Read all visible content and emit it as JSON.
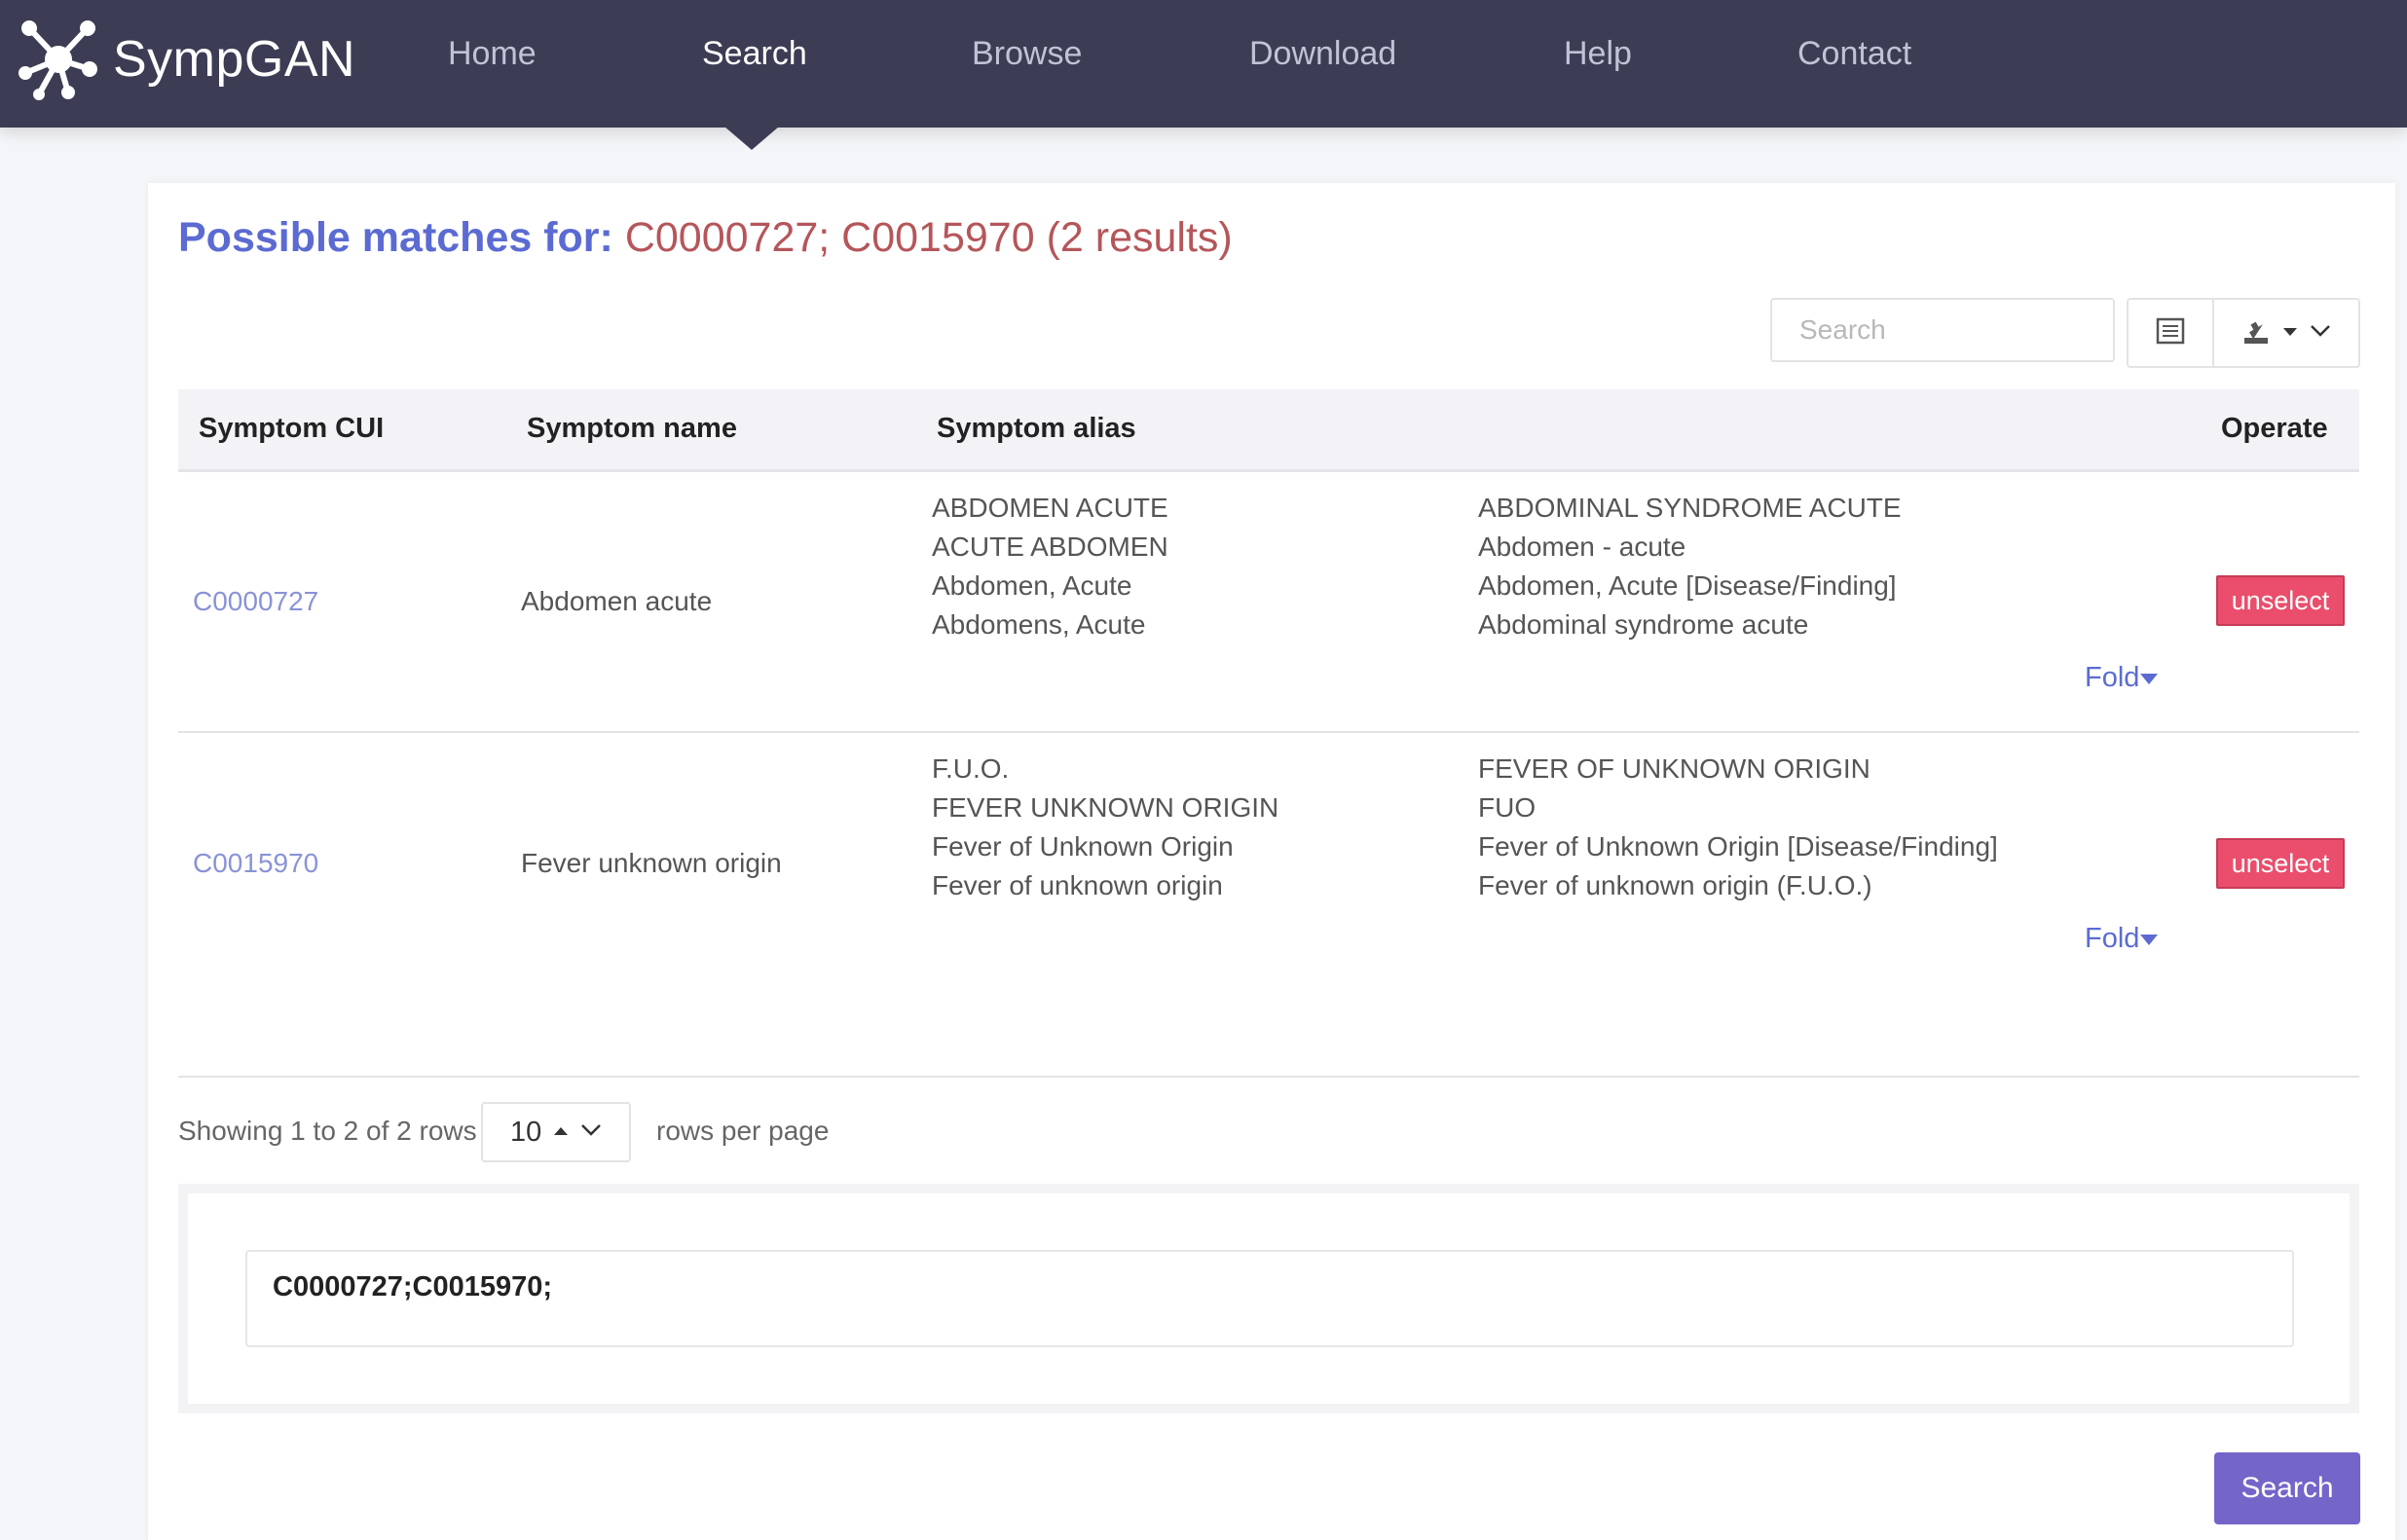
{
  "brand": {
    "name": "SympGAN",
    "logo_icon": "molecule-network-icon"
  },
  "nav": {
    "items": [
      {
        "label": "Home",
        "active": false
      },
      {
        "label": "Search",
        "active": true
      },
      {
        "label": "Browse",
        "active": false
      },
      {
        "label": "Download",
        "active": false
      },
      {
        "label": "Help",
        "active": false
      },
      {
        "label": "Contact",
        "active": false
      }
    ]
  },
  "heading": {
    "label": "Possible matches for:",
    "value": "C0000727; C0015970 (2 results)"
  },
  "toolbar": {
    "search_placeholder": "Search",
    "columns_icon": "list-view-icon",
    "export_icon": "download-export-icon"
  },
  "table": {
    "headers": {
      "cui": "Symptom CUI",
      "name": "Symptom name",
      "alias": "Symptom alias",
      "operate": "Operate"
    },
    "rows": [
      {
        "cui": "C0000727",
        "name": "Abdomen acute",
        "alias_col1": [
          "ABDOMEN ACUTE",
          "ACUTE ABDOMEN",
          "Abdomen, Acute",
          "Abdomens, Acute"
        ],
        "alias_col2": [
          "ABDOMINAL SYNDROME ACUTE",
          "Abdomen - acute",
          "Abdomen, Acute [Disease/Finding]",
          "Abdominal syndrome acute"
        ],
        "fold_label": "Fold",
        "action_label": "unselect"
      },
      {
        "cui": "C0015970",
        "name": "Fever unknown origin",
        "alias_col1": [
          "F.U.O.",
          "FEVER UNKNOWN ORIGIN",
          "Fever of Unknown Origin",
          "Fever of unknown origin"
        ],
        "alias_col2": [
          "FEVER OF UNKNOWN ORIGIN",
          "FUO",
          "Fever of Unknown Origin [Disease/Finding]",
          "Fever of unknown origin (F.U.O.)"
        ],
        "fold_label": "Fold",
        "action_label": "unselect"
      }
    ]
  },
  "pagination": {
    "summary": "Showing 1 to 2 of 2 rows",
    "page_size": "10",
    "suffix": "rows per page"
  },
  "query": {
    "value": "C0000727;C0015970;"
  },
  "search_button": {
    "label": "Search"
  },
  "colors": {
    "navbar": "#3c3c54",
    "accent": "#5b6bd2",
    "result": "#b5565a",
    "unselect": "#ea4e6c",
    "search_button": "#7465c9"
  }
}
